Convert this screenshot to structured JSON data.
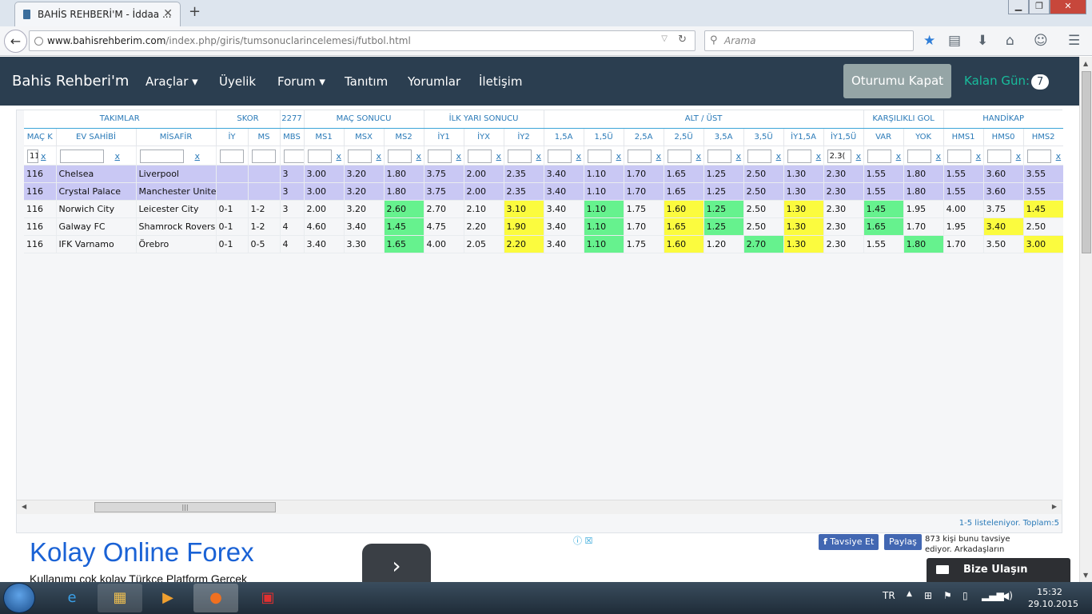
{
  "browser": {
    "tab_title": "BAHİS REHBERİ'M - İddaa ...",
    "url_domain": "www.bahisrehberim.com",
    "url_path": "/index.php/giris/tumsonuclarincelemesi/futbol.html",
    "search_placeholder": "Arama"
  },
  "site": {
    "brand": "Bahis Rehberi'm",
    "nav": [
      "Araçlar",
      "Üyelik",
      "Forum",
      "Tanıtım",
      "Yorumlar",
      "İletişim"
    ],
    "logout": "Oturumu Kapat",
    "kalan_label": "Kalan Gün:",
    "kalan_value": "7"
  },
  "grid": {
    "groups": [
      "TAKIMLAR",
      "SKOR",
      "2277",
      "MAÇ SONUCU",
      "İLK YARI SONUCU",
      "ALT / ÜST",
      "KARŞILIKLI GOL",
      "HANDİKAP"
    ],
    "columns": [
      "MAÇ K",
      "EV SAHİBİ",
      "MİSAFİR",
      "İY",
      "MS",
      "MBS",
      "MS1",
      "MSX",
      "MS2",
      "İY1",
      "İYX",
      "İY2",
      "1,5A",
      "1,5Ü",
      "2,5A",
      "2,5Ü",
      "3,5A",
      "3,5Ü",
      "İY1,5A",
      "İY1,5Ü",
      "VAR",
      "YOK",
      "HMS1",
      "HMS0",
      "HMS2"
    ],
    "filters": [
      "11",
      "",
      "",
      "",
      "",
      "",
      "",
      "",
      "",
      "",
      "",
      "",
      "",
      "",
      "",
      "",
      "",
      "",
      "",
      "2.3(",
      "",
      "",
      "",
      "",
      ""
    ],
    "clear": "x",
    "rows": [
      {
        "hl": true,
        "cells": [
          "116",
          "Chelsea",
          "Liverpool",
          "",
          "",
          "3",
          "3.00",
          "3.20",
          "1.80",
          "3.75",
          "2.00",
          "2.35",
          "3.40",
          "1.10",
          "1.70",
          "1.65",
          "1.25",
          "2.50",
          "1.30",
          "2.30",
          "1.55",
          "1.80",
          "1.55",
          "3.60",
          "3.55"
        ],
        "colors": [
          "",
          "",
          "",
          "",
          "",
          "",
          "",
          "",
          "",
          "",
          "",
          "",
          "",
          "",
          "",
          "",
          "",
          "",
          "",
          "",
          "",
          "",
          "",
          "",
          ""
        ]
      },
      {
        "hl": true,
        "cells": [
          "116",
          "Crystal Palace",
          "Manchester United",
          "",
          "",
          "3",
          "3.00",
          "3.20",
          "1.80",
          "3.75",
          "2.00",
          "2.35",
          "3.40",
          "1.10",
          "1.70",
          "1.65",
          "1.25",
          "2.50",
          "1.30",
          "2.30",
          "1.55",
          "1.80",
          "1.55",
          "3.60",
          "3.55"
        ],
        "colors": [
          "",
          "",
          "",
          "",
          "",
          "",
          "",
          "",
          "",
          "",
          "",
          "",
          "",
          "",
          "",
          "",
          "",
          "",
          "",
          "",
          "",
          "",
          "",
          "",
          ""
        ]
      },
      {
        "hl": false,
        "cells": [
          "116",
          "Norwich City",
          "Leicester City",
          "0-1",
          "1-2",
          "3",
          "2.00",
          "3.20",
          "2.60",
          "2.70",
          "2.10",
          "3.10",
          "3.40",
          "1.10",
          "1.75",
          "1.60",
          "1.25",
          "2.50",
          "1.30",
          "2.30",
          "1.45",
          "1.95",
          "4.00",
          "3.75",
          "1.45"
        ],
        "colors": [
          "",
          "",
          "",
          "",
          "",
          "",
          "",
          "",
          "g",
          "",
          "",
          "y",
          "",
          "g",
          "",
          "y",
          "g",
          "",
          "y",
          "",
          "g",
          "",
          "",
          "",
          "y"
        ]
      },
      {
        "hl": false,
        "cells": [
          "116",
          "Galway FC",
          "Shamrock Rovers",
          "0-1",
          "1-2",
          "4",
          "4.60",
          "3.40",
          "1.45",
          "4.75",
          "2.20",
          "1.90",
          "3.40",
          "1.10",
          "1.70",
          "1.65",
          "1.25",
          "2.50",
          "1.30",
          "2.30",
          "1.65",
          "1.70",
          "1.95",
          "3.40",
          "2.50"
        ],
        "colors": [
          "",
          "",
          "",
          "",
          "",
          "",
          "",
          "",
          "g",
          "",
          "",
          "y",
          "",
          "g",
          "",
          "y",
          "g",
          "",
          "y",
          "",
          "g",
          "",
          "",
          "y",
          ""
        ]
      },
      {
        "hl": false,
        "cells": [
          "116",
          "IFK Varnamo",
          "Örebro",
          "0-1",
          "0-5",
          "4",
          "3.40",
          "3.30",
          "1.65",
          "4.00",
          "2.05",
          "2.20",
          "3.40",
          "1.10",
          "1.75",
          "1.60",
          "1.20",
          "2.70",
          "1.30",
          "2.30",
          "1.55",
          "1.80",
          "1.70",
          "3.50",
          "3.00"
        ],
        "colors": [
          "",
          "",
          "",
          "",
          "",
          "",
          "",
          "",
          "g",
          "",
          "",
          "y",
          "",
          "g",
          "",
          "y",
          "",
          "g",
          "y",
          "",
          "",
          "g",
          "",
          "",
          "y"
        ]
      }
    ],
    "pager": "1-5 listeleniyor. Toplam:5"
  },
  "ad": {
    "title": "Kolay Online Forex",
    "subtitle": "Kullanımı çok kolay Türkçe Platform Gerçek",
    "fb_like": "Tavsiye Et",
    "fb_share": "Paylaş",
    "fb_text": "873 kişi bunu tavsiye ediyor. Arkadaşların"
  },
  "contact": "Bize Ulaşın",
  "taskbar": {
    "lang": "TR",
    "time": "15:32",
    "date": "29.10.2015"
  },
  "colors": {
    "hl": "#c9c8f4",
    "green": "#66f28e",
    "yellow": "#fbfb3e",
    "navbar": "#2b3e50",
    "accent": "#18bc9c"
  }
}
